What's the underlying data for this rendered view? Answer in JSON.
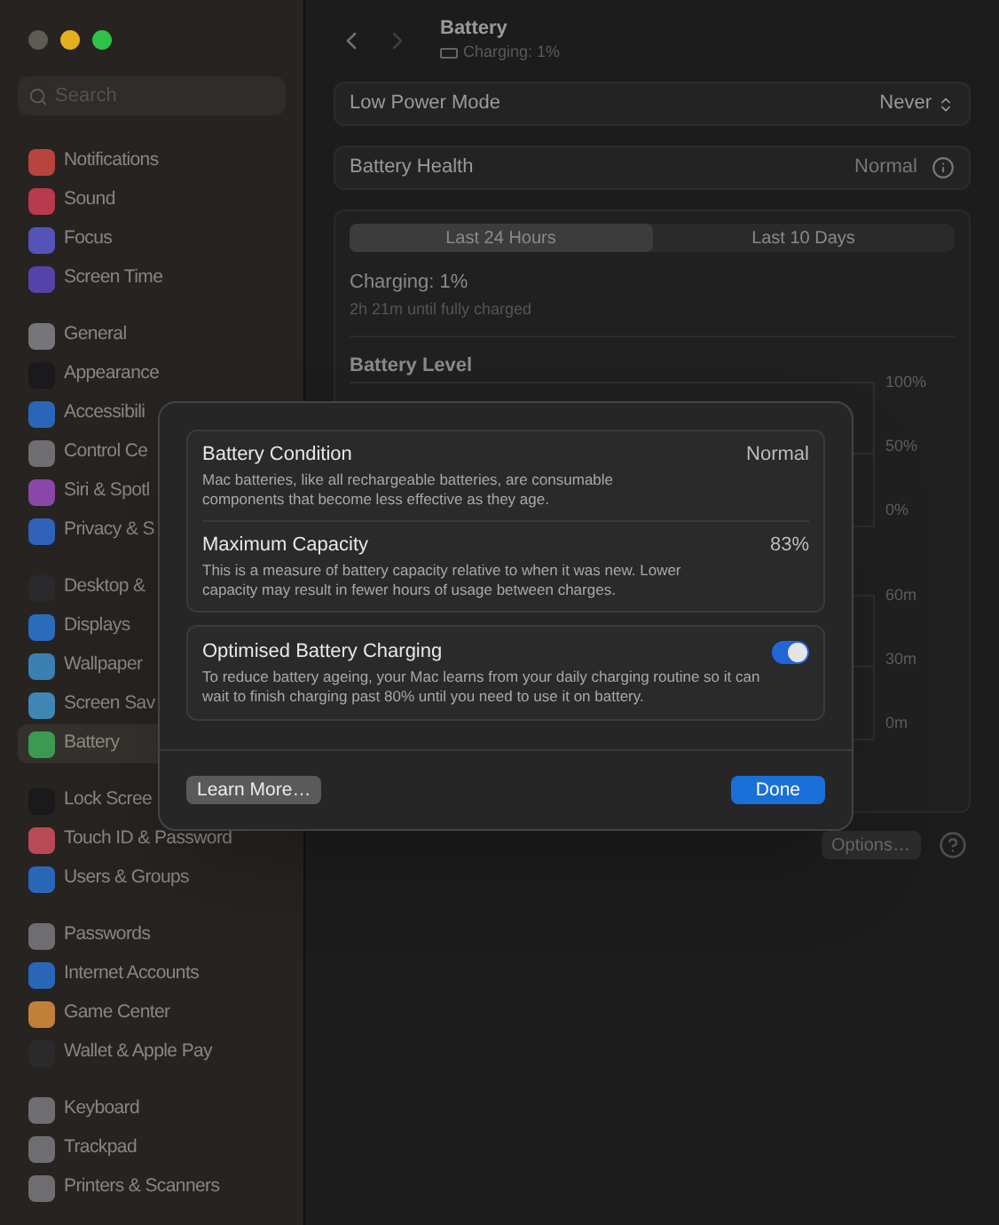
{
  "sidebar": {
    "search": {
      "placeholder": "Search"
    },
    "groups": [
      [
        {
          "label": "Notifications",
          "color": "#b8443e",
          "selected": false
        },
        {
          "label": "Sound",
          "color": "#b83a4c",
          "selected": false
        },
        {
          "label": "Focus",
          "color": "#5553b8",
          "selected": false
        },
        {
          "label": "Screen Time",
          "color": "#5443a8",
          "selected": false
        }
      ],
      [
        {
          "label": "General",
          "color": "#76767a",
          "selected": false
        },
        {
          "label": "Appearance",
          "color": "#1a1a1c",
          "selected": false
        },
        {
          "label": "Accessibili",
          "color": "#2a66b8",
          "selected": false
        },
        {
          "label": "Control Ce",
          "color": "#6e6e72",
          "selected": false
        },
        {
          "label": "Siri & Spotl",
          "color": "#8a46a8",
          "selected": false
        },
        {
          "label": "Privacy & S",
          "color": "#2f62b8",
          "selected": false
        }
      ],
      [
        {
          "label": "Desktop &",
          "color": "#2a2a2c",
          "selected": false
        },
        {
          "label": "Displays",
          "color": "#2a6cbc",
          "selected": false
        },
        {
          "label": "Wallpaper",
          "color": "#3a80b0",
          "selected": false
        },
        {
          "label": "Screen Sav",
          "color": "#3f86b4",
          "selected": false
        },
        {
          "label": "Battery",
          "color": "#3a9a52",
          "selected": true
        }
      ],
      [
        {
          "label": "Lock Scree",
          "color": "#1a1a1c",
          "selected": false
        },
        {
          "label": "Touch ID & Password",
          "color": "#b84a55",
          "selected": false
        },
        {
          "label": "Users & Groups",
          "color": "#2a66b8",
          "selected": false
        }
      ],
      [
        {
          "label": "Passwords",
          "color": "#6e6e72",
          "selected": false
        },
        {
          "label": "Internet Accounts",
          "color": "#2a66b8",
          "selected": false
        },
        {
          "label": "Game Center",
          "color": "#c0803a",
          "selected": false
        },
        {
          "label": "Wallet & Apple Pay",
          "color": "#2a2a2c",
          "selected": false
        }
      ],
      [
        {
          "label": "Keyboard",
          "color": "#6e6e72",
          "selected": false
        },
        {
          "label": "Trackpad",
          "color": "#6e6e72",
          "selected": false
        },
        {
          "label": "Printers & Scanners",
          "color": "#6e6e72",
          "selected": false
        }
      ]
    ]
  },
  "header": {
    "title": "Battery",
    "subtitle": "Charging: 1%"
  },
  "settings": [
    {
      "kind": "select",
      "label": "Low Power Mode",
      "value": "Never"
    },
    {
      "kind": "info",
      "label": "Battery Health",
      "value": "Normal"
    }
  ],
  "usage": {
    "tabs": [
      {
        "label": "Last 24 Hours",
        "selected": true
      },
      {
        "label": "Last 10 Days",
        "selected": false
      }
    ],
    "status": "Charging: 1%",
    "detail": "2h 21m until fully charged",
    "chart_title": "Battery Level",
    "level_axis": [
      "100%",
      "50%",
      "0%"
    ],
    "usage_axis": [
      "60m",
      "30m",
      "0m"
    ]
  },
  "options_button": "Options…",
  "dialog": {
    "rows": [
      {
        "title": "Battery Condition",
        "value": "Normal",
        "description": "Mac batteries, like all rechargeable batteries, are consumable components that become less effective as they age."
      },
      {
        "title": "Maximum Capacity",
        "value": "83%",
        "description": "This is a measure of battery capacity relative to when it was new. Lower capacity may result in fewer hours of usage between charges."
      }
    ],
    "toggle": {
      "title": "Optimised Battery Charging",
      "description": "To reduce battery ageing, your Mac learns from your daily charging routine so it can wait to finish charging past 80% until you need to use it on battery.",
      "on": true
    },
    "buttons": [
      {
        "label": "Learn More…",
        "kind": "secondary"
      },
      {
        "label": "Done",
        "kind": "primary"
      }
    ]
  }
}
